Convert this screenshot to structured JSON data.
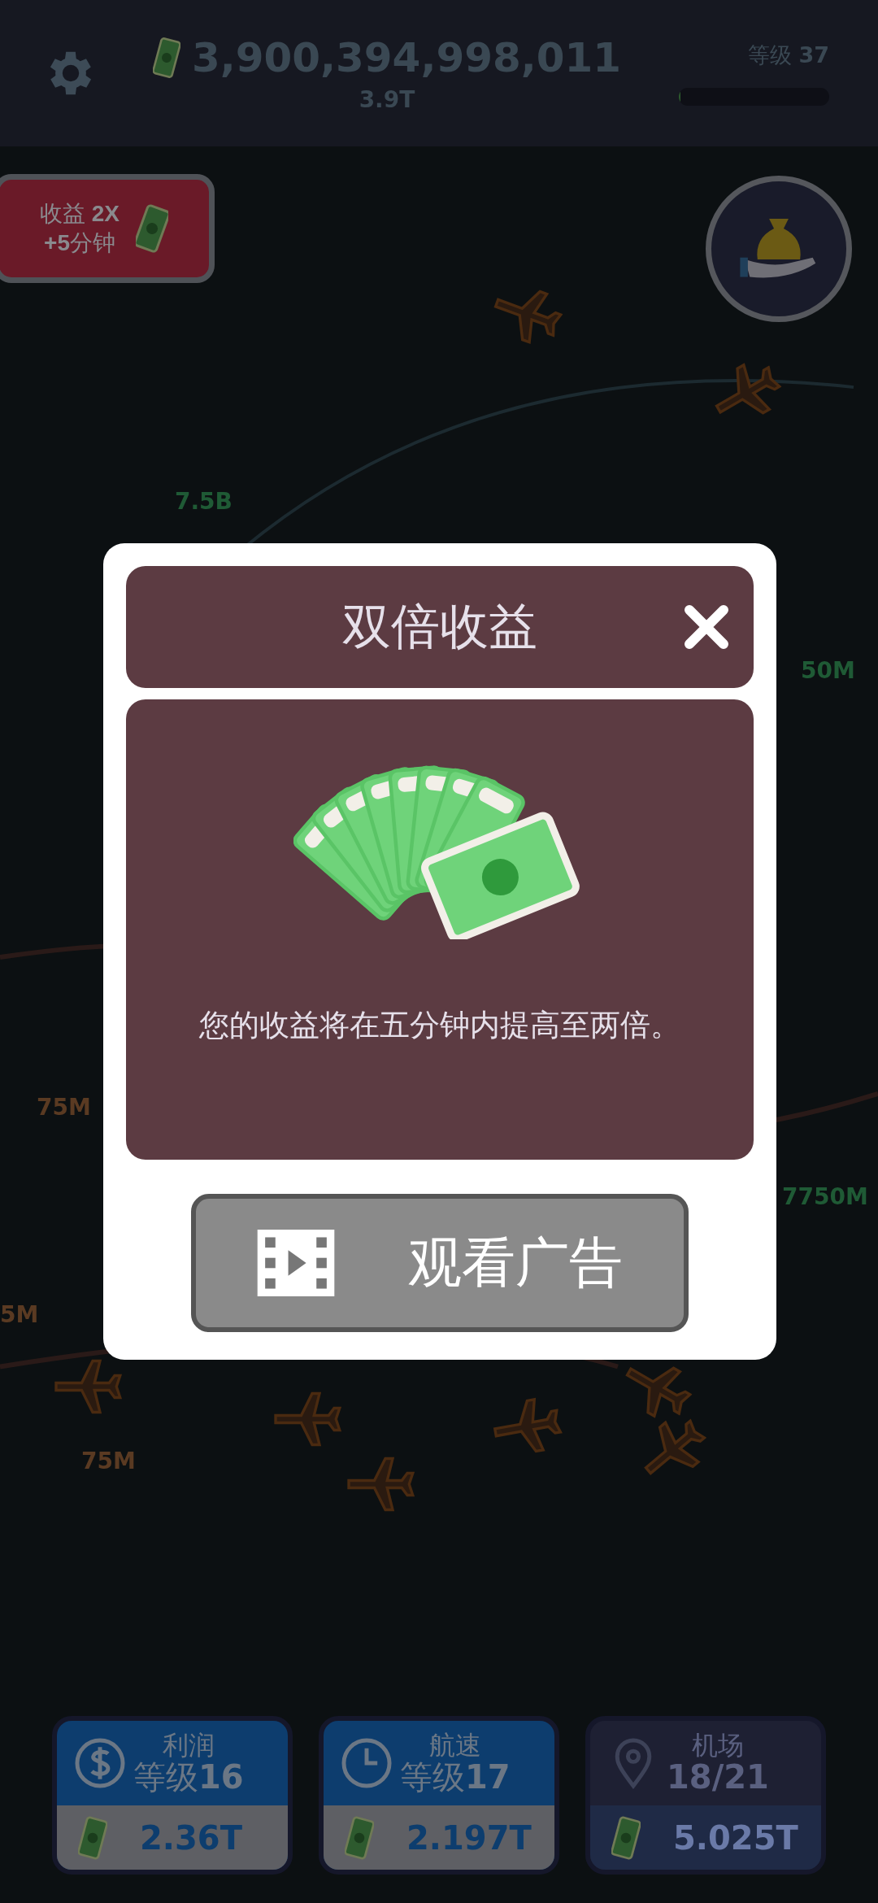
{
  "top_bar": {
    "balance": "3,900,394,998,011",
    "balance_short": "3.9T",
    "level_label": "等级",
    "level_value": "37",
    "level": 0.01
  },
  "boost_button": {
    "line1_label": "收益",
    "line1_value": "2X",
    "line2": "+5分钟"
  },
  "map_labels": [
    {
      "text": "7.5B",
      "kind": "green"
    },
    {
      "text": "50M",
      "kind": "green"
    },
    {
      "text": "75M",
      "kind": "orange"
    },
    {
      "text": "7750M",
      "kind": "green"
    },
    {
      "text": "5M",
      "kind": "orange"
    },
    {
      "text": "75M",
      "kind": "orange"
    }
  ],
  "dialog": {
    "title": "双倍收益",
    "message": "您的收益将在五分钟内提高至两倍。",
    "button": "观看广告"
  },
  "upgrades": [
    {
      "kind": "profit",
      "title": "利润",
      "level_label": "等级",
      "level_value": "16",
      "cost": "2.36T",
      "disabled": false
    },
    {
      "kind": "speed",
      "title": "航速",
      "level_label": "等级",
      "level_value": "17",
      "cost": "2.197T",
      "disabled": false
    },
    {
      "kind": "airport",
      "title": "机场",
      "level_value": "18/21",
      "cost": "5.025T",
      "disabled": true
    }
  ]
}
